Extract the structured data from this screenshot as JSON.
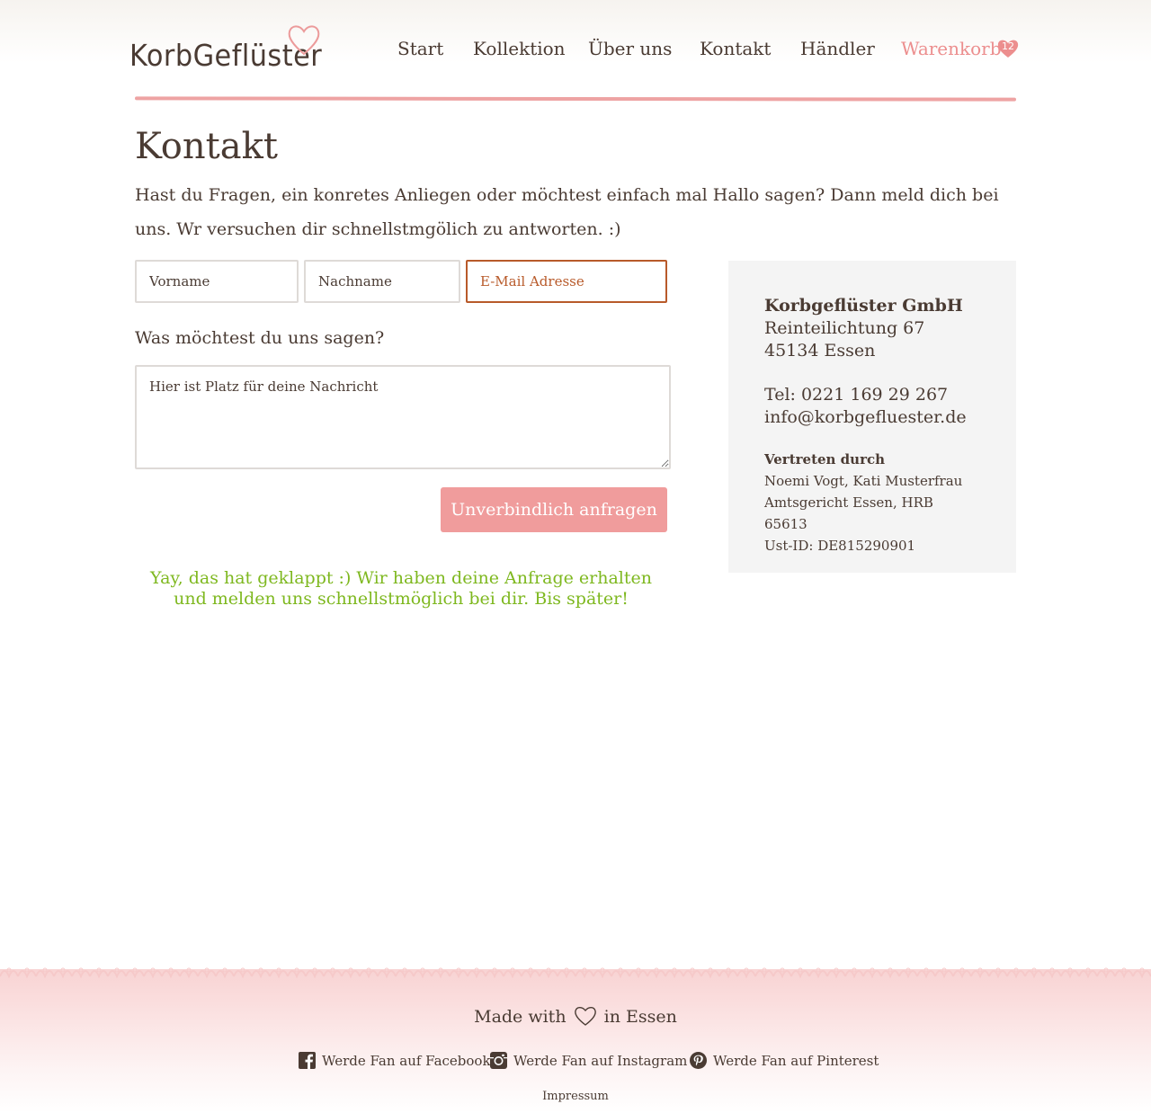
{
  "header": {
    "logo": "KorbGeflüster",
    "nav": [
      {
        "label": "Start"
      },
      {
        "label": "Kollektion"
      },
      {
        "label": "Über uns"
      },
      {
        "label": "Kontakt"
      },
      {
        "label": "Händler"
      }
    ],
    "cart": {
      "label": "Warenkorb",
      "count": "12"
    }
  },
  "page": {
    "title": "Kontakt",
    "intro": "Hast du Fragen, ein konretes Anliegen oder möchtest einfach mal Hallo sagen? Dann meld dich bei uns. Wr versuchen dir schnellstmgölich zu antworten. :)"
  },
  "form": {
    "firstname_placeholder": "Vorname",
    "lastname_placeholder": "Nachname",
    "email_placeholder": "E-Mail Adresse",
    "message_label": "Was möchtest du uns sagen?",
    "message_placeholder": "Hier ist Platz für deine Nachricht",
    "submit_label": "Unverbindlich anfragen",
    "success_message": "Yay, das hat geklappt :) Wir haben deine Anfrage erhalten und melden uns schnellstmöglich bei dir. Bis später!"
  },
  "contact_info": {
    "company": "Korbgeflüster GmbH",
    "street": "Reinteilichtung 67",
    "city": "45134 Essen",
    "phone": "Tel: 0221 169 29 267",
    "email": "info@korbgefluester.de",
    "represented_label": "Vertreten durch",
    "representatives": "Noemi Vogt, Kati Musterfrau",
    "court": "Amtsgericht Essen, HRB 65613",
    "vat": "Ust-ID: DE815290901"
  },
  "footer": {
    "made_with_prefix": "Made with",
    "made_with_suffix": "in Essen",
    "social": [
      {
        "label": "Werde Fan auf Facebook",
        "icon": "facebook-icon"
      },
      {
        "label": "Werde Fan auf Instagram",
        "icon": "instagram-icon"
      },
      {
        "label": "Werde Fan auf Pinterest",
        "icon": "pinterest-icon"
      }
    ],
    "impressum": "Impressum"
  },
  "colors": {
    "text": "#4a3b33",
    "accent_pink": "#f09c9c",
    "cart_pink": "#ec8e8e",
    "success_green": "#7eb81f",
    "email_focus": "#b85a2a",
    "info_bg": "#f4f4f4"
  }
}
